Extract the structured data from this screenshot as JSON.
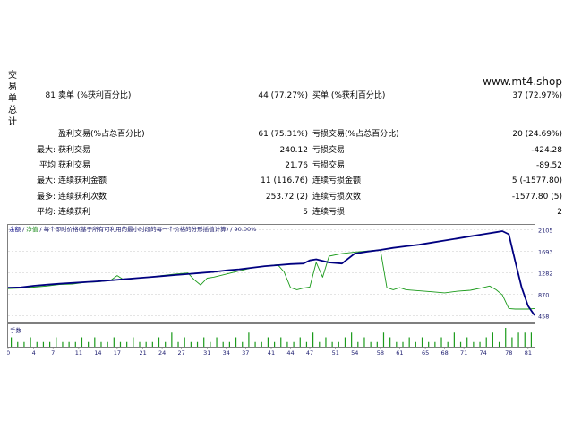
{
  "section_label": [
    "交",
    "易",
    "单",
    "总",
    "计"
  ],
  "site_label": "www.mt4.shop",
  "rows": [
    {
      "c1": "81",
      "c2": "卖单 (%获利百分比)",
      "c3": "44 (77.27%)",
      "c4": "买单 (%获利百分比)",
      "c5": "37 (72.97%)"
    },
    {
      "c1": "",
      "c2": "盈利交易(%占总百分比)",
      "c3": "61 (75.31%)",
      "c4": "亏损交易(%占总百分比)",
      "c5": "20 (24.69%)"
    },
    {
      "c1": "最大:",
      "c2": "获利交易",
      "c3": "240.12",
      "c4": "亏损交易",
      "c5": "-424.28"
    },
    {
      "c1": "平均",
      "c2": "获利交易",
      "c3": "21.76",
      "c4": "亏损交易",
      "c5": "-89.52"
    },
    {
      "c1": "最大:",
      "c2": "连续获利金额",
      "c3": "11 (116.76)",
      "c4": "连续亏损金额",
      "c5": "5 (-1577.80)"
    },
    {
      "c1": "最多:",
      "c2": "连续获利次数",
      "c3": "253.72 (2)",
      "c4": "连续亏损次数",
      "c5": "-1577.80 (5)"
    },
    {
      "c1": "平均:",
      "c2": "连续获利",
      "c3": "5",
      "c4": "连续亏损",
      "c5": "2"
    }
  ],
  "chart": {
    "legend_balance": "余额",
    "legend_sep": " / ",
    "legend_equity": "净值",
    "legend_rest": " / 每个即时价格(基于所有可利用的最小时段的每一个价格的分形插值计算) / 90.00%",
    "volume_label": "手数",
    "colors": {
      "balance": "#000080",
      "equity": "#1a9a1a",
      "volume": "#1a9a1a",
      "grid": "#c8c8c8"
    }
  },
  "chart_data": {
    "type": "line",
    "x_ticks": [
      "0",
      "4",
      "7",
      "11",
      "14",
      "17",
      "21",
      "24",
      "27",
      "31",
      "34",
      "37",
      "41",
      "44",
      "47",
      "51",
      "54",
      "58",
      "61",
      "65",
      "68",
      "71",
      "74",
      "78",
      "81"
    ],
    "y_ticks": [
      "2105",
      "1693",
      "1282",
      "870",
      "458"
    ],
    "ylim": [
      350,
      2200
    ],
    "xlim": [
      0,
      82
    ],
    "series": [
      {
        "name": "余额",
        "x": [
          0,
          2,
          4,
          6,
          8,
          10,
          12,
          14,
          16,
          18,
          20,
          22,
          24,
          26,
          28,
          30,
          32,
          34,
          36,
          38,
          40,
          42,
          44,
          46,
          47,
          48,
          50,
          52,
          54,
          56,
          58,
          60,
          62,
          64,
          66,
          68,
          70,
          72,
          74,
          76,
          77,
          78,
          79,
          80,
          81,
          82
        ],
        "y": [
          1000,
          1005,
          1035,
          1055,
          1075,
          1090,
          1105,
          1120,
          1140,
          1160,
          1180,
          1200,
          1220,
          1240,
          1260,
          1280,
          1300,
          1330,
          1350,
          1380,
          1410,
          1430,
          1450,
          1460,
          1520,
          1540,
          1480,
          1460,
          1650,
          1690,
          1720,
          1760,
          1790,
          1820,
          1860,
          1900,
          1940,
          1980,
          2020,
          2060,
          2080,
          2020,
          1500,
          1000,
          650,
          470
        ]
      },
      {
        "name": "净值",
        "x": [
          0,
          2,
          4,
          6,
          8,
          10,
          12,
          14,
          16,
          17,
          18,
          20,
          22,
          24,
          26,
          28,
          29,
          30,
          31,
          32,
          34,
          36,
          38,
          40,
          42,
          43,
          44,
          45,
          46,
          47,
          48,
          49,
          50,
          52,
          54,
          56,
          58,
          59,
          60,
          61,
          62,
          64,
          66,
          68,
          70,
          72,
          74,
          75,
          76,
          77,
          78,
          79,
          80,
          81,
          82
        ],
        "y": [
          980,
          990,
          1010,
          1030,
          1060,
          1070,
          1100,
          1110,
          1140,
          1230,
          1150,
          1180,
          1200,
          1230,
          1260,
          1280,
          1150,
          1050,
          1180,
          1200,
          1260,
          1320,
          1380,
          1410,
          1440,
          1300,
          1000,
          960,
          990,
          1010,
          1480,
          1200,
          1600,
          1650,
          1680,
          1700,
          1720,
          1000,
          960,
          1000,
          960,
          940,
          920,
          900,
          930,
          950,
          1000,
          1030,
          960,
          860,
          600,
          590,
          590,
          590,
          600
        ]
      }
    ],
    "volume": [
      2,
      1,
      1,
      2,
      1,
      1,
      1,
      2,
      1,
      1,
      1,
      2,
      1,
      2,
      1,
      1,
      2,
      1,
      1,
      2,
      1,
      1,
      1,
      2,
      1,
      3,
      1,
      2,
      1,
      1,
      2,
      1,
      2,
      1,
      1,
      2,
      1,
      3,
      1,
      1,
      2,
      1,
      2,
      1,
      1,
      2,
      1,
      3,
      1,
      2,
      1,
      1,
      2,
      3,
      1,
      2,
      1,
      1,
      3,
      2,
      1,
      1,
      2,
      1,
      2,
      1,
      1,
      2,
      1,
      3,
      1,
      2,
      1,
      1,
      2,
      3,
      1,
      4,
      2,
      3,
      3,
      3
    ]
  }
}
